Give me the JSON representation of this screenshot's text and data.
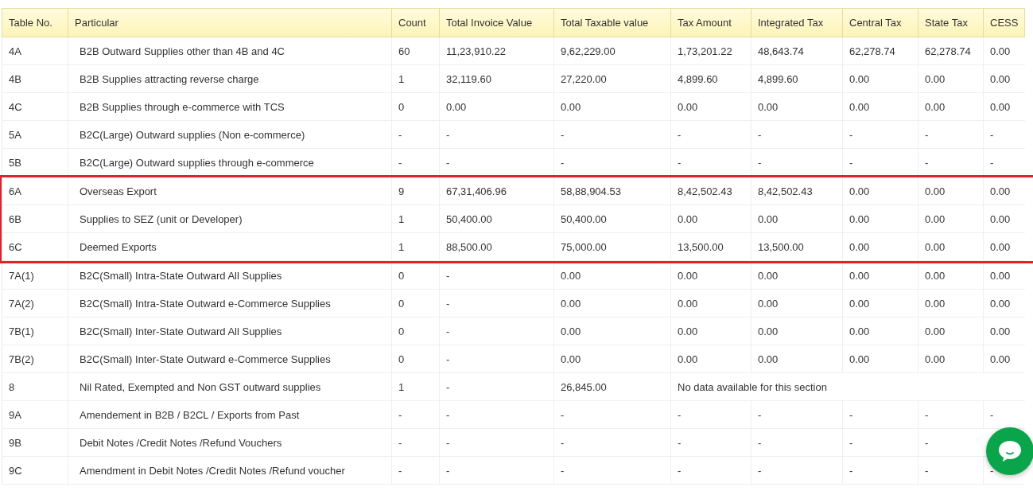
{
  "table": {
    "columns": [
      "Table No.",
      "Particular",
      "Count",
      "Total Invoice Value",
      "Total Taxable value",
      "Tax Amount",
      "Integrated Tax",
      "Central Tax",
      "State Tax",
      "CESS"
    ],
    "rows": [
      {
        "cells": [
          "4A",
          "B2B Outward Supplies other than 4B and 4C",
          "60",
          "11,23,910.22",
          "9,62,229.00",
          "1,73,201.22",
          "48,643.74",
          "62,278.74",
          "62,278.74",
          "0.00"
        ],
        "highlighted": false
      },
      {
        "cells": [
          "4B",
          "B2B Supplies attracting reverse charge",
          "1",
          "32,119.60",
          "27,220.00",
          "4,899.60",
          "4,899.60",
          "0.00",
          "0.00",
          "0.00"
        ],
        "highlighted": false
      },
      {
        "cells": [
          "4C",
          "B2B Supplies through e-commerce with TCS",
          "0",
          "0.00",
          "0.00",
          "0.00",
          "0.00",
          "0.00",
          "0.00",
          "0.00"
        ],
        "highlighted": false
      },
      {
        "cells": [
          "5A",
          "B2C(Large) Outward supplies (Non e-commerce)",
          "-",
          "-",
          "-",
          "-",
          "-",
          "-",
          "-",
          "-"
        ],
        "highlighted": false
      },
      {
        "cells": [
          "5B",
          "B2C(Large) Outward supplies through e-commerce",
          "-",
          "-",
          "-",
          "-",
          "-",
          "-",
          "-",
          "-"
        ],
        "highlighted": false
      },
      {
        "cells": [
          "6A",
          "Overseas Export",
          "9",
          "67,31,406.96",
          "58,88,904.53",
          "8,42,502.43",
          "8,42,502.43",
          "0.00",
          "0.00",
          "0.00"
        ],
        "highlighted": true
      },
      {
        "cells": [
          "6B",
          "Supplies to SEZ (unit or Developer)",
          "1",
          "50,400.00",
          "50,400.00",
          "0.00",
          "0.00",
          "0.00",
          "0.00",
          "0.00"
        ],
        "highlighted": true
      },
      {
        "cells": [
          "6C",
          "Deemed Exports",
          "1",
          "88,500.00",
          "75,000.00",
          "13,500.00",
          "13,500.00",
          "0.00",
          "0.00",
          "0.00"
        ],
        "highlighted": true
      },
      {
        "cells": [
          "7A(1)",
          "B2C(Small) Intra-State Outward All Supplies",
          "0",
          "-",
          "0.00",
          "0.00",
          "0.00",
          "0.00",
          "0.00",
          "0.00"
        ],
        "highlighted": false
      },
      {
        "cells": [
          "7A(2)",
          "B2C(Small) Intra-State Outward e-Commerce Supplies",
          "0",
          "-",
          "0.00",
          "0.00",
          "0.00",
          "0.00",
          "0.00",
          "0.00"
        ],
        "highlighted": false
      },
      {
        "cells": [
          "7B(1)",
          "B2C(Small) Inter-State Outward All Supplies",
          "0",
          "-",
          "0.00",
          "0.00",
          "0.00",
          "0.00",
          "0.00",
          "0.00"
        ],
        "highlighted": false
      },
      {
        "cells": [
          "7B(2)",
          "B2C(Small) Inter-State Outward e-Commerce Supplies",
          "0",
          "-",
          "0.00",
          "0.00",
          "0.00",
          "0.00",
          "0.00",
          "0.00"
        ],
        "highlighted": false
      },
      {
        "cells": [
          "8",
          "Nil Rated, Exempted and Non GST outward supplies",
          "1",
          "-",
          "26,845.00"
        ],
        "note": "No data available for this section",
        "highlighted": false
      },
      {
        "cells": [
          "9A",
          "Amendement in B2B / B2CL / Exports from Past",
          "-",
          "-",
          "-",
          "-",
          "-",
          "-",
          "-",
          "-"
        ],
        "highlighted": false
      },
      {
        "cells": [
          "9B",
          "Debit Notes /Credit Notes /Refund Vouchers",
          "-",
          "-",
          "-",
          "-",
          "-",
          "-",
          "-"
        ],
        "highlighted": false
      },
      {
        "cells": [
          "9C",
          "Amendment in Debit Notes /Credit Notes /Refund voucher",
          "-",
          "-",
          "-",
          "-",
          "-",
          "-",
          "-",
          "-"
        ],
        "highlighted": false
      }
    ]
  }
}
